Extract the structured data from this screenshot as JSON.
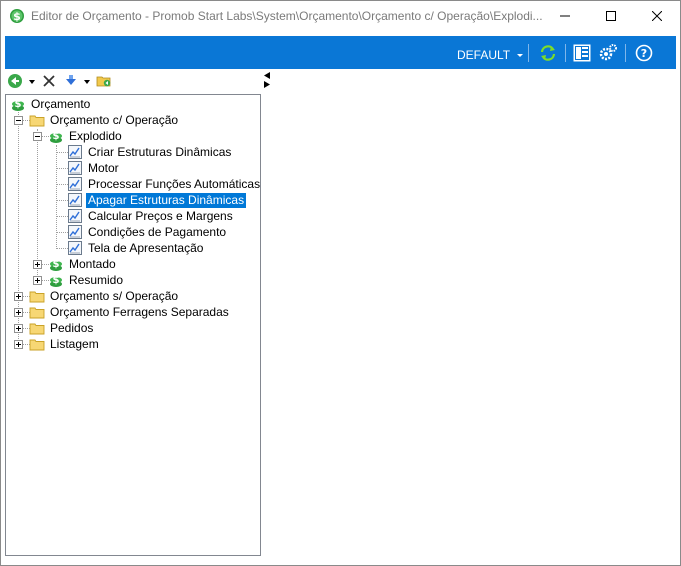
{
  "window": {
    "title": "Editor de Orçamento - Promob Start Labs\\System\\Orçamento\\Orçamento c/ Operação\\Explodi..."
  },
  "ribbon": {
    "profile_label": "DEFAULT",
    "accent": "#0a77d6"
  },
  "tree": {
    "root": "Orçamento",
    "com_operacao": "Orçamento c/ Operação",
    "explodido": "Explodido",
    "items": [
      "Criar Estruturas Dinâmicas",
      "Motor",
      "Processar Funções Automáticas",
      "Apagar Estruturas Dinâmicas",
      "Calcular Preços e Margens",
      "Condições de Pagamento",
      "Tela de Apresentação"
    ],
    "selected_item": "Apagar Estruturas Dinâmicas",
    "montado": "Montado",
    "resumido": "Resumido",
    "sem_operacao": "Orçamento s/ Operação",
    "ferragens": "Orçamento Ferragens Separadas",
    "pedidos": "Pedidos",
    "listagem": "Listagem"
  }
}
